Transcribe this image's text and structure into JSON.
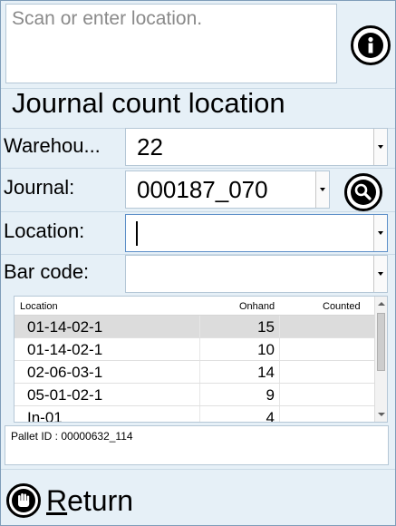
{
  "scan": {
    "placeholder": "Scan or enter location."
  },
  "title": "Journal count location",
  "fields": {
    "warehouse": {
      "label": "Warehou...",
      "value": "22"
    },
    "journal": {
      "label": "Journal:",
      "value": "000187_070"
    },
    "location": {
      "label": "Location:",
      "value": ""
    },
    "barcode": {
      "label": "Bar code:",
      "value": ""
    }
  },
  "grid": {
    "columns": [
      "Location",
      "Onhand",
      "Counted"
    ],
    "rows": [
      {
        "location": "01-14-02-1",
        "onhand": "15",
        "counted": ""
      },
      {
        "location": "01-14-02-1",
        "onhand": "10",
        "counted": ""
      },
      {
        "location": "02-06-03-1",
        "onhand": "14",
        "counted": ""
      },
      {
        "location": "05-01-02-1",
        "onhand": "9",
        "counted": ""
      },
      {
        "location": "In-01",
        "onhand": "4",
        "counted": ""
      }
    ]
  },
  "pallet_info": "Pallet ID : 00000632_114",
  "return": {
    "label_first": "R",
    "label_rest": "eturn"
  },
  "icons": {
    "info": "info-icon",
    "search": "search-icon",
    "stop": "stop-hand-icon"
  }
}
